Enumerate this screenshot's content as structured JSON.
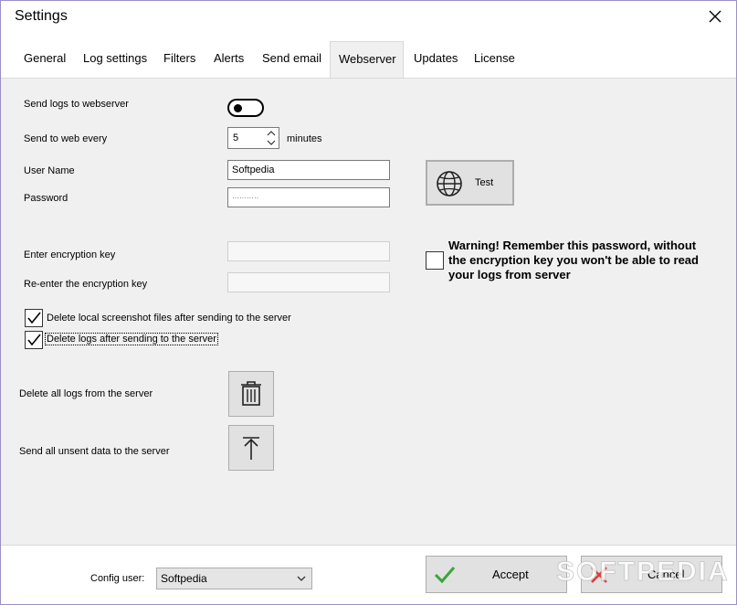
{
  "window": {
    "title": "Settings"
  },
  "tabs": [
    "General",
    "Log settings",
    "Filters",
    "Alerts",
    "Send email",
    "Webserver",
    "Updates",
    "License"
  ],
  "form": {
    "send_logs_label": "Send logs to webserver",
    "send_logs_enabled": false,
    "send_every_label": "Send to web every",
    "send_every_value": "5",
    "send_every_unit": "minutes",
    "username_label": "User Name",
    "username_value": "Softpedia",
    "password_label": "Password",
    "password_value": "···········",
    "test_label": "Test",
    "enc_key_label": "Enter encryption key",
    "enc_key_value": "",
    "reenc_key_label": "Re-enter the encryption key",
    "reenc_key_value": "",
    "warning_text": "Warning! Remember this password, without the encryption key you won't be able to read your logs from server",
    "warning_checked": false,
    "delete_screens_label": "Delete local screenshot files after sending to the server",
    "delete_screens_checked": true,
    "delete_logs_label": "Delete logs after sending to the server",
    "delete_logs_checked": true,
    "delete_all_label": "Delete all logs from the server",
    "send_unsent_label": "Send all unsent data to the server"
  },
  "footer": {
    "config_user_label": "Config user:",
    "config_user_value": "Softpedia",
    "accept_label": "Accept",
    "cancel_label": "Cancel",
    "watermark": "SOFTPEDIA"
  },
  "colors": {
    "accept_check": "#3aa53a",
    "cancel_x": "#e03c3c",
    "panel_bg": "#f0f0f0"
  }
}
